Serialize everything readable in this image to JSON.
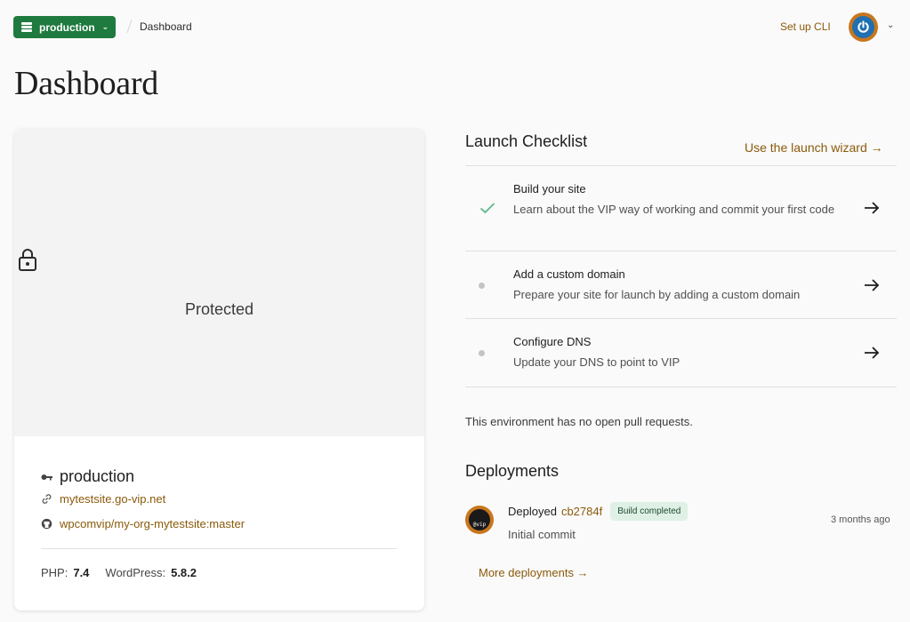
{
  "header": {
    "env_selector": "production",
    "breadcrumb": "Dashboard",
    "cli_link": "Set up CLI"
  },
  "page_title": "Dashboard",
  "site_card": {
    "preview_status": "Protected",
    "environment_name": "production",
    "domain": "mytestsite.go-vip.net",
    "repo": "wpcomvip/my-org-mytestsite:master",
    "php_label": "PHP:",
    "php_version": "7.4",
    "wp_label": "WordPress:",
    "wp_version": "5.8.2"
  },
  "checklist": {
    "title": "Launch Checklist",
    "wizard_link": "Use the launch wizard →",
    "tasks": [
      {
        "title": "Build your site",
        "description": "Learn about the VIP way of working and commit your first code",
        "status": "done"
      },
      {
        "title": "Add a custom domain",
        "description": "Prepare your site for launch by adding a custom domain",
        "status": "pending"
      },
      {
        "title": "Configure DNS",
        "description": "Update your DNS to point to VIP",
        "status": "pending"
      }
    ]
  },
  "pull_requests": {
    "empty_text": "This environment has no open pull requests."
  },
  "deployments": {
    "title": "Deployments",
    "items": [
      {
        "action": "Deployed",
        "commit": "cb2784f",
        "badge": "Build completed",
        "time": "3 months ago",
        "message": "Initial commit",
        "avatar_text": "@vip"
      }
    ],
    "more_link": "More deployments →"
  },
  "colors": {
    "accent_green": "#1f7a3f",
    "link_brown": "#8a5a0a",
    "check_green": "#5cb88a",
    "badge_bg": "#dff1e6"
  },
  "icons": {
    "env": "server-list-icon",
    "lock": "lock-icon",
    "key": "key-icon",
    "link": "link-icon",
    "repo": "github-icon",
    "check": "checkmark-icon",
    "arrow": "arrow-right-icon",
    "user": "power-icon"
  }
}
